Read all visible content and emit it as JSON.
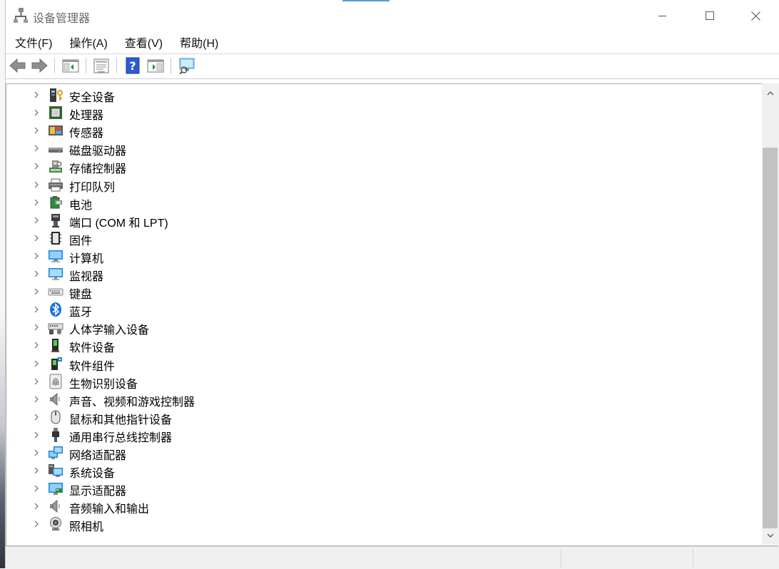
{
  "window": {
    "title": "设备管理器"
  },
  "menu": {
    "items": [
      "文件(F)",
      "操作(A)",
      "查看(V)",
      "帮助(H)"
    ]
  },
  "toolbar": {
    "buttons": [
      "back-icon",
      "forward-icon",
      "show-hide-tree-icon",
      "properties-icon",
      "help-icon",
      "action-pane-icon",
      "scan-hardware-icon"
    ]
  },
  "tree": {
    "items": [
      {
        "label": "安全设备",
        "icon": "security-device-icon"
      },
      {
        "label": "处理器",
        "icon": "processor-icon"
      },
      {
        "label": "传感器",
        "icon": "sensor-icon"
      },
      {
        "label": "磁盘驱动器",
        "icon": "disk-drive-icon"
      },
      {
        "label": "存储控制器",
        "icon": "storage-controller-icon"
      },
      {
        "label": "打印队列",
        "icon": "printer-icon"
      },
      {
        "label": "电池",
        "icon": "battery-icon"
      },
      {
        "label": "端口 (COM 和 LPT)",
        "icon": "port-icon"
      },
      {
        "label": "固件",
        "icon": "firmware-icon"
      },
      {
        "label": "计算机",
        "icon": "computer-icon"
      },
      {
        "label": "监视器",
        "icon": "monitor-icon"
      },
      {
        "label": "键盘",
        "icon": "keyboard-icon"
      },
      {
        "label": "蓝牙",
        "icon": "bluetooth-icon"
      },
      {
        "label": "人体学输入设备",
        "icon": "hid-icon"
      },
      {
        "label": "软件设备",
        "icon": "software-device-icon"
      },
      {
        "label": "软件组件",
        "icon": "software-component-icon"
      },
      {
        "label": "生物识别设备",
        "icon": "biometric-icon"
      },
      {
        "label": "声音、视频和游戏控制器",
        "icon": "sound-icon"
      },
      {
        "label": "鼠标和其他指针设备",
        "icon": "mouse-icon"
      },
      {
        "label": "通用串行总线控制器",
        "icon": "usb-icon"
      },
      {
        "label": "网络适配器",
        "icon": "network-adapter-icon"
      },
      {
        "label": "系统设备",
        "icon": "system-device-icon"
      },
      {
        "label": "显示适配器",
        "icon": "display-adapter-icon"
      },
      {
        "label": "音频输入和输出",
        "icon": "audio-io-icon"
      },
      {
        "label": "照相机",
        "icon": "camera-icon"
      }
    ]
  },
  "statusbar": {
    "segments": [
      "",
      "",
      ""
    ]
  }
}
